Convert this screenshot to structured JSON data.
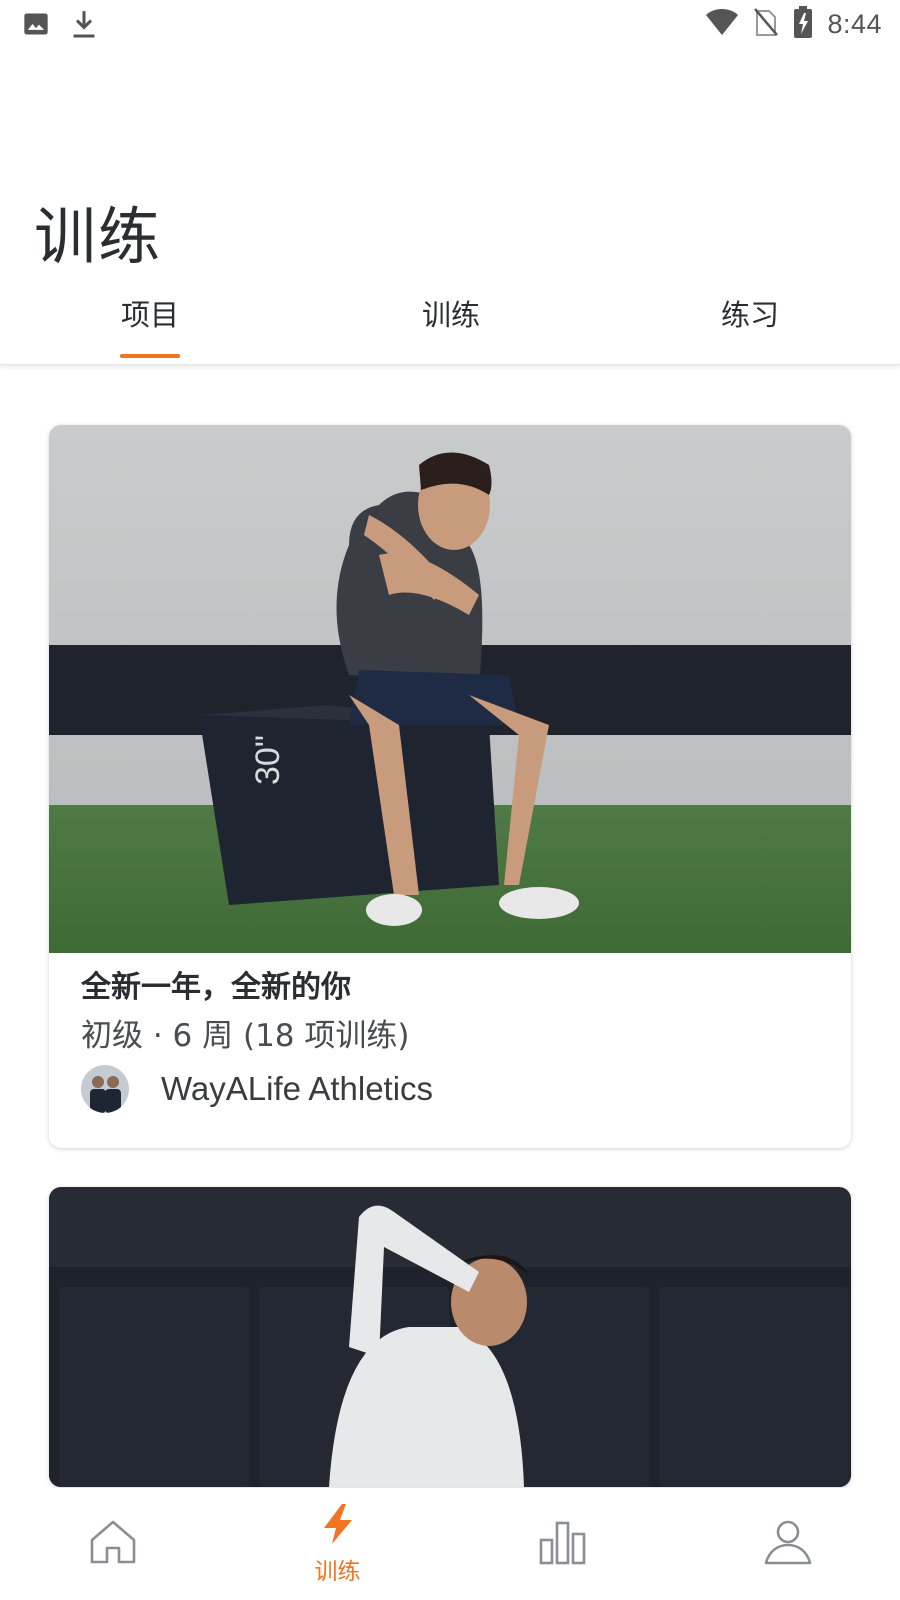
{
  "status_bar": {
    "time": "8:44",
    "icons": [
      "image-icon",
      "download-icon",
      "wifi-icon",
      "no-sim-icon",
      "battery-charging-icon"
    ]
  },
  "page": {
    "title": "训练"
  },
  "tabs": [
    {
      "label": "项目",
      "active": true
    },
    {
      "label": "训练",
      "active": false
    },
    {
      "label": "练习",
      "active": false
    }
  ],
  "cards": [
    {
      "title": "全新一年，全新的你",
      "meta": "初级 · 6 周 (18 项训练)",
      "author": "WayALife Athletics"
    }
  ],
  "bottom_nav": {
    "items": [
      {
        "icon": "home-icon",
        "label": ""
      },
      {
        "icon": "lightning-icon",
        "label": "训练",
        "active": true
      },
      {
        "icon": "stats-icon",
        "label": ""
      },
      {
        "icon": "profile-icon",
        "label": ""
      }
    ]
  },
  "colors": {
    "accent": "#f07422",
    "text": "#2b2d33"
  }
}
